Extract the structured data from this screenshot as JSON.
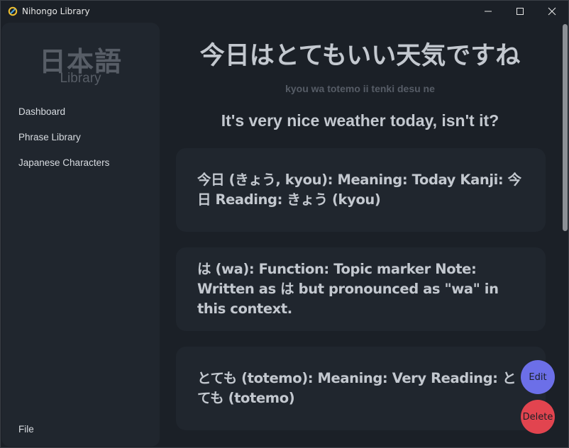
{
  "window": {
    "title": "Nihongo Library"
  },
  "sidebar": {
    "logo_jp": "日本語",
    "logo_sub": "Library",
    "items": [
      {
        "label": "Dashboard"
      },
      {
        "label": "Phrase Library"
      },
      {
        "label": "Japanese Characters"
      }
    ],
    "file_label": "File"
  },
  "phrase": {
    "japanese": "今日はとてもいい天気ですね",
    "romaji": "kyou wa totemo ii tenki desu ne",
    "english": "It's very nice weather today, isn't it?"
  },
  "breakdown": [
    {
      "text": "今日 (きょう, kyou): Meaning: Today Kanji: 今日 Reading: きょう (kyou)"
    },
    {
      "text": "は (wa): Function: Topic marker Note: Written as は but pronounced as \"wa\" in this context."
    },
    {
      "text": "とても (totemo): Meaning: Very Reading: とても (totemo)"
    }
  ],
  "actions": {
    "edit_label": "Edit",
    "delete_label": "Delete"
  },
  "colors": {
    "background": "#1b2027",
    "panel": "#20262e",
    "edit": "#6c6fe8",
    "delete": "#e2444f"
  },
  "icons": {
    "app": "app-logo-icon",
    "minimize": "minimize-icon",
    "maximize": "maximize-icon",
    "close": "close-icon"
  }
}
